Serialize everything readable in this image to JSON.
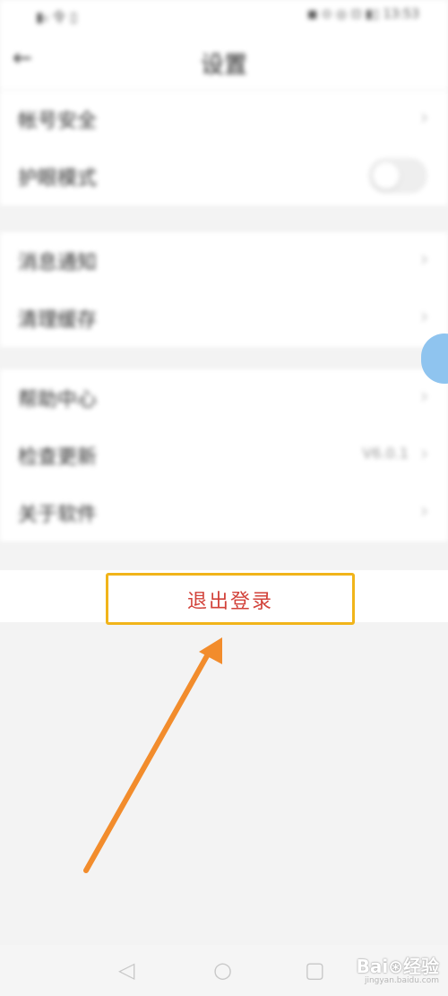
{
  "status_bar": {
    "left": "▮ᵢₗ 令 ▯",
    "right": "◼ ⊙ ◎ ⊡ ▮▯ 13:53"
  },
  "nav": {
    "back_icon": "←",
    "title": "设置"
  },
  "groups": [
    {
      "items": [
        {
          "label": "帐号安全",
          "kind": "chevron"
        },
        {
          "label": "护眼模式",
          "kind": "toggle",
          "toggle_on": false
        }
      ]
    },
    {
      "items": [
        {
          "label": "消息通知",
          "kind": "chevron"
        },
        {
          "label": "清理缓存",
          "kind": "chevron"
        }
      ]
    },
    {
      "items": [
        {
          "label": "帮助中心",
          "kind": "chevron"
        },
        {
          "label": "检查更新",
          "kind": "value",
          "value": "V6.0.1"
        },
        {
          "label": "关于软件",
          "kind": "chevron"
        }
      ]
    }
  ],
  "chevron_glyph": "›",
  "logout": {
    "label": "退出登录",
    "highlight_color": "#f1b41a",
    "text_color": "#d2423a"
  },
  "annotation_arrow_color": "#f28c2c",
  "system_nav": {
    "back_icon": "◁",
    "home_icon": "○",
    "recent_icon": "▢"
  },
  "watermark": {
    "brand": "Bai⊛经验",
    "url": "jingyan.baidu.com"
  }
}
